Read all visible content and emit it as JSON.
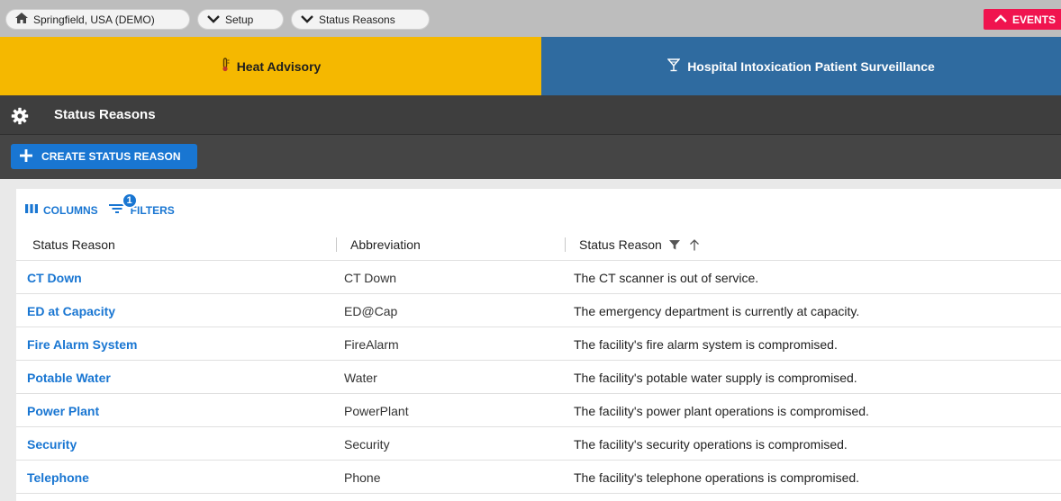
{
  "breadcrumbs": [
    {
      "label": "Springfield, USA (DEMO)",
      "icon": "home-icon"
    },
    {
      "label": "Setup",
      "icon": "chevron-down-icon"
    },
    {
      "label": "Status Reasons",
      "icon": "chevron-down-icon"
    }
  ],
  "events_label": "EVENTS",
  "banners": {
    "heat": {
      "label": "Heat Advisory",
      "icon": "thermometer-icon",
      "color": "#f5b800"
    },
    "hospital": {
      "label": "Hospital Intoxication Patient Surveillance",
      "icon": "cocktail-icon",
      "color": "#2f6ba0"
    }
  },
  "section": {
    "title": "Status Reasons",
    "icon": "gear-icon"
  },
  "toolbar": {
    "create_label": "CREATE STATUS REASON"
  },
  "grid": {
    "columns_label": "COLUMNS",
    "filters_label": "FILTERS",
    "filter_count": "1",
    "headers": [
      "Status Reason",
      "Abbreviation",
      "Status Reason"
    ],
    "rows": [
      {
        "name": "CT Down",
        "abbr": "CT Down",
        "desc": "The CT scanner is out of service."
      },
      {
        "name": "ED at Capacity",
        "abbr": "ED@Cap",
        "desc": "The emergency department is currently at capacity."
      },
      {
        "name": "Fire Alarm System",
        "abbr": "FireAlarm",
        "desc": "The facility's fire alarm system is compromised."
      },
      {
        "name": "Potable Water",
        "abbr": "Water",
        "desc": "The facility's potable water supply is compromised."
      },
      {
        "name": "Power Plant",
        "abbr": "PowerPlant",
        "desc": "The facility's power plant operations is compromised."
      },
      {
        "name": "Security",
        "abbr": "Security",
        "desc": "The facility's security operations is compromised."
      },
      {
        "name": "Telephone",
        "abbr": "Phone",
        "desc": "The facility's telephone operations is compromised."
      }
    ]
  },
  "colors": {
    "accent": "#1976d2",
    "events": "#f0144f"
  }
}
